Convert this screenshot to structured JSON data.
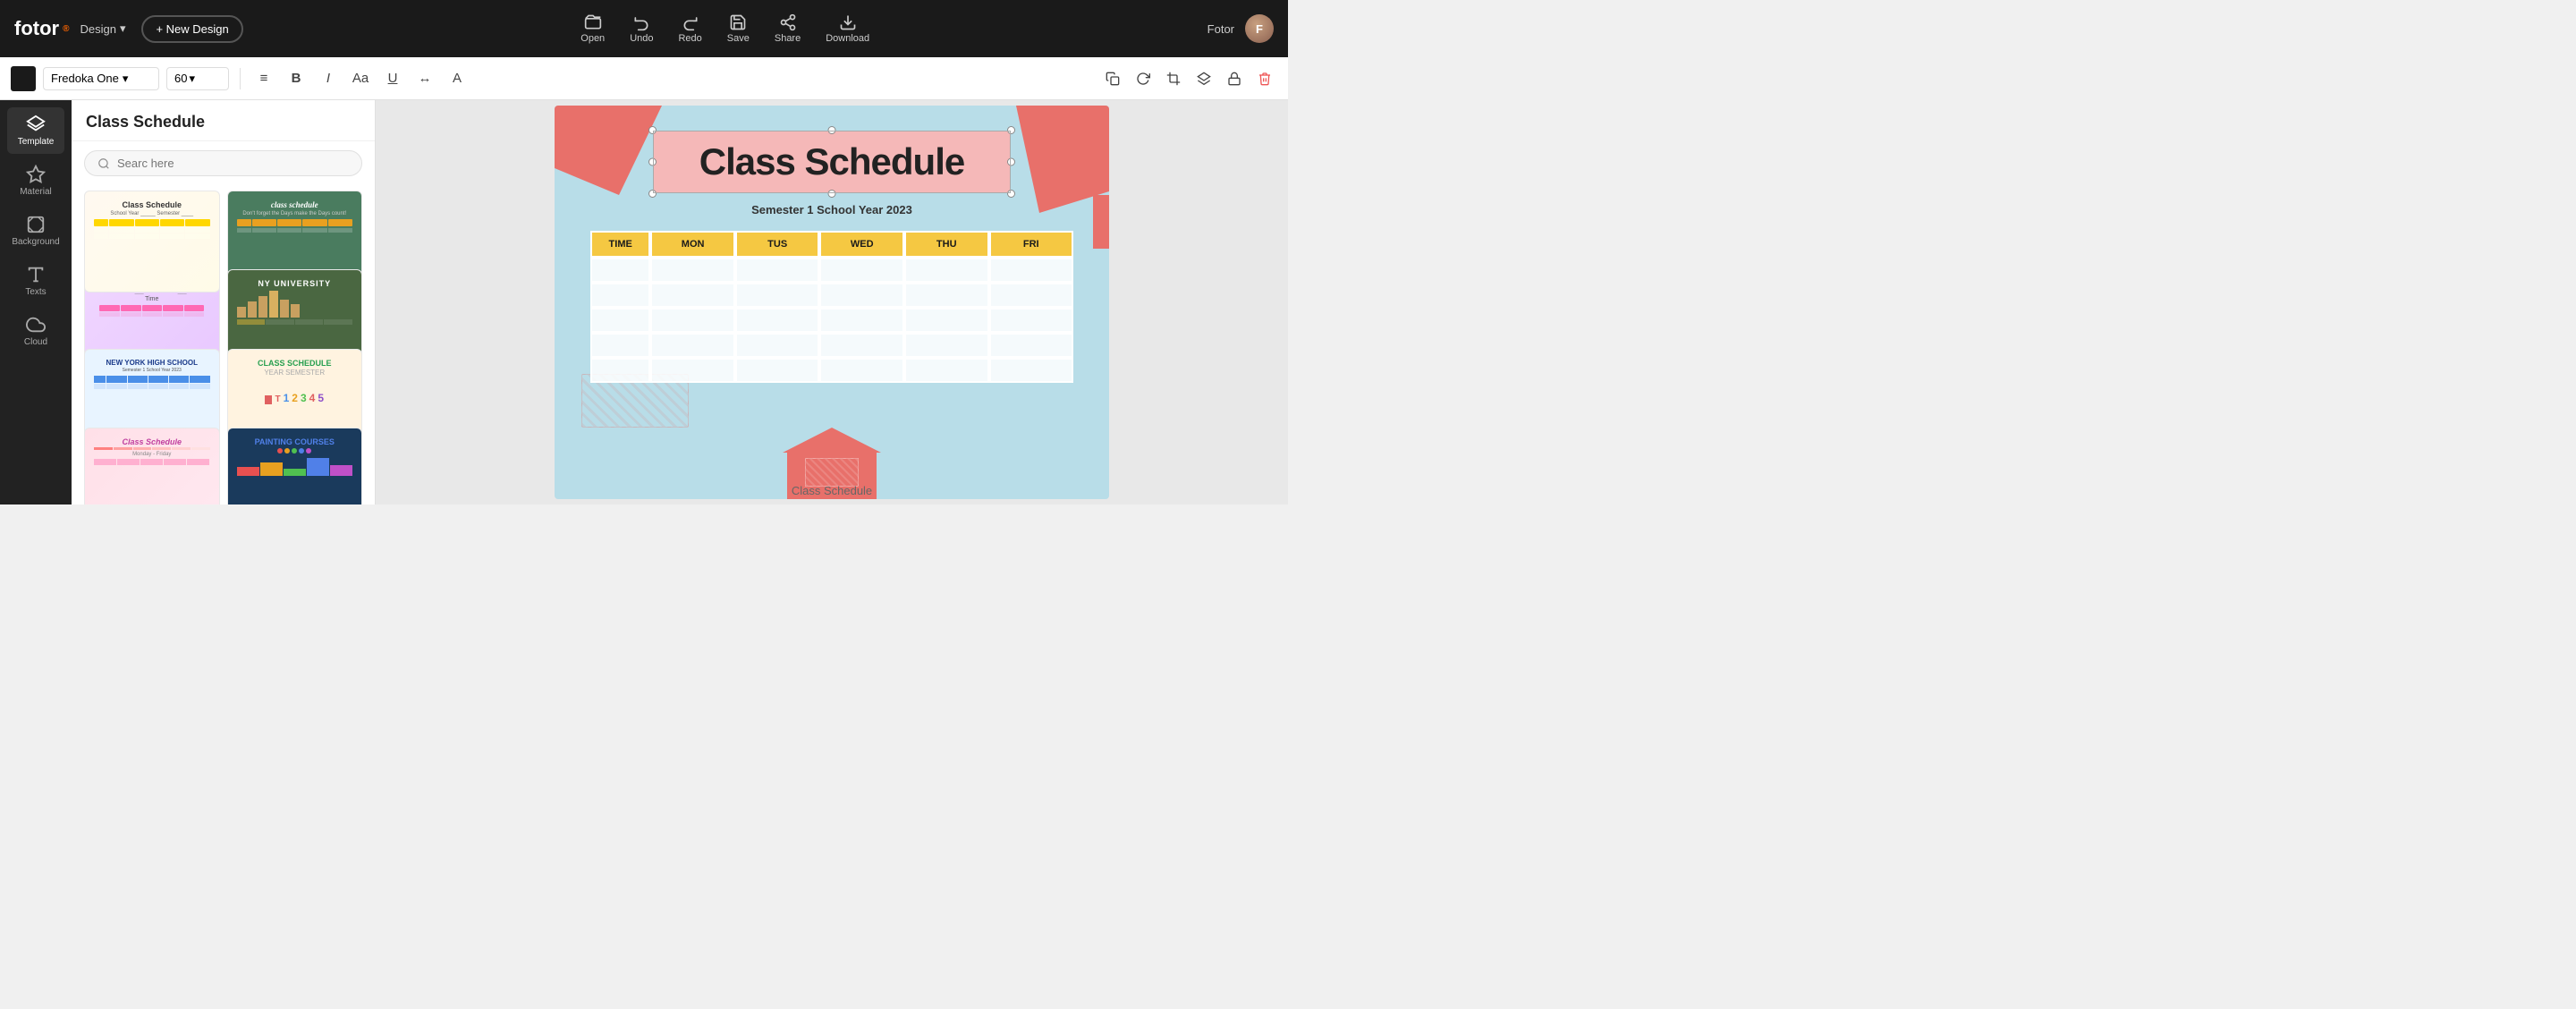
{
  "app": {
    "logo": "fotor",
    "logo_superscript": "®",
    "design_label": "Design",
    "new_design_label": "+ New Design",
    "username": "Fotor"
  },
  "topbar_actions": [
    {
      "id": "open",
      "label": "Open",
      "icon": "open-icon"
    },
    {
      "id": "undo",
      "label": "Undo",
      "icon": "undo-icon"
    },
    {
      "id": "redo",
      "label": "Redo",
      "icon": "redo-icon"
    },
    {
      "id": "save",
      "label": "Save",
      "icon": "save-icon"
    },
    {
      "id": "share",
      "label": "Share",
      "icon": "share-icon"
    },
    {
      "id": "download",
      "label": "Download",
      "icon": "download-icon"
    }
  ],
  "toolbar": {
    "font_color": "#1a1a1a",
    "font_name": "Fredoka One",
    "font_size": "60",
    "align_icon": "≡",
    "bold": "B",
    "italic": "I",
    "size_aa": "Aa",
    "underline": "U",
    "letter_spacing": "↔",
    "case": "A"
  },
  "sidebar": {
    "items": [
      {
        "id": "template",
        "label": "Template",
        "icon": "layers-icon",
        "active": true
      },
      {
        "id": "material",
        "label": "Material",
        "icon": "star-icon",
        "active": false
      },
      {
        "id": "background",
        "label": "Background",
        "icon": "background-icon",
        "active": false
      },
      {
        "id": "texts",
        "label": "Texts",
        "icon": "text-icon",
        "active": false
      },
      {
        "id": "cloud",
        "label": "Cloud",
        "icon": "cloud-icon",
        "active": false
      }
    ]
  },
  "panel": {
    "title": "Class Schedule",
    "search_placeholder": "Searc here"
  },
  "templates": [
    {
      "id": 1,
      "label": "Class Schedule - Yellow",
      "style": "thumb-1"
    },
    {
      "id": 2,
      "label": "class schedule - Dark Green",
      "style": "thumb-2"
    },
    {
      "id": 3,
      "label": "Class Schedule - Purple",
      "style": "thumb-3"
    },
    {
      "id": 4,
      "label": "NY University - Green",
      "style": "thumb-4"
    },
    {
      "id": 5,
      "label": "New York High School - Blue",
      "style": "thumb-5"
    },
    {
      "id": 6,
      "label": "Class Schedule - Colorful",
      "style": "thumb-6"
    },
    {
      "id": 7,
      "label": "Class Schedule - Pink",
      "style": "thumb-7"
    },
    {
      "id": 8,
      "label": "Painting Courses - Dark",
      "style": "thumb-8"
    }
  ],
  "canvas": {
    "title": "Class Schedule",
    "subtitle": "Semester 1 School Year 2023",
    "table_headers": [
      "TIME",
      "MON",
      "TUS",
      "WED",
      "THU",
      "FRI"
    ],
    "empty_rows": 5
  },
  "bottom_label": "Class Schedule"
}
